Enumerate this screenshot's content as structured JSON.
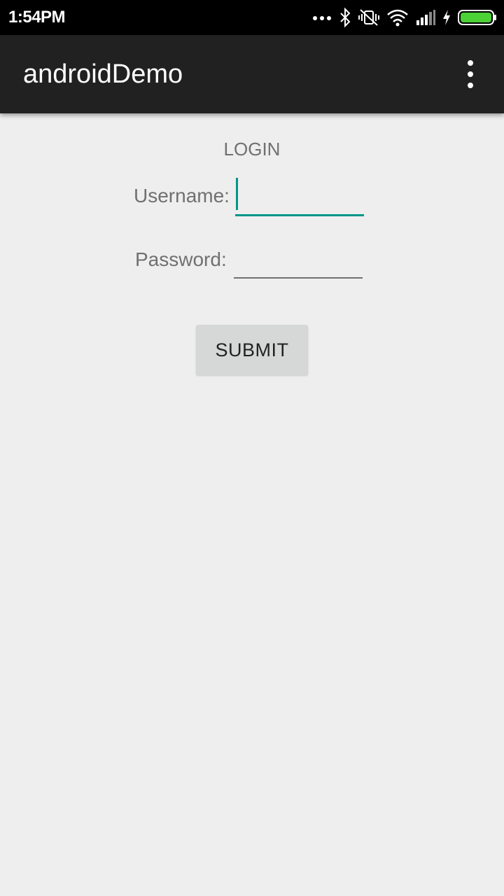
{
  "status_bar": {
    "time": "1:54PM",
    "icons": [
      "more-icon",
      "bluetooth-icon",
      "vibrate-off-icon",
      "wifi-icon",
      "signal-icon",
      "charging-icon",
      "battery-icon"
    ],
    "battery_color": "#4cd137"
  },
  "app_bar": {
    "title": "androidDemo",
    "menu_icon": "overflow-menu-icon"
  },
  "form": {
    "title": "LOGIN",
    "username_label": "Username:",
    "username_value": "",
    "password_label": "Password:",
    "password_value": "",
    "submit_label": "SUBMIT",
    "accent_color": "#009688"
  }
}
